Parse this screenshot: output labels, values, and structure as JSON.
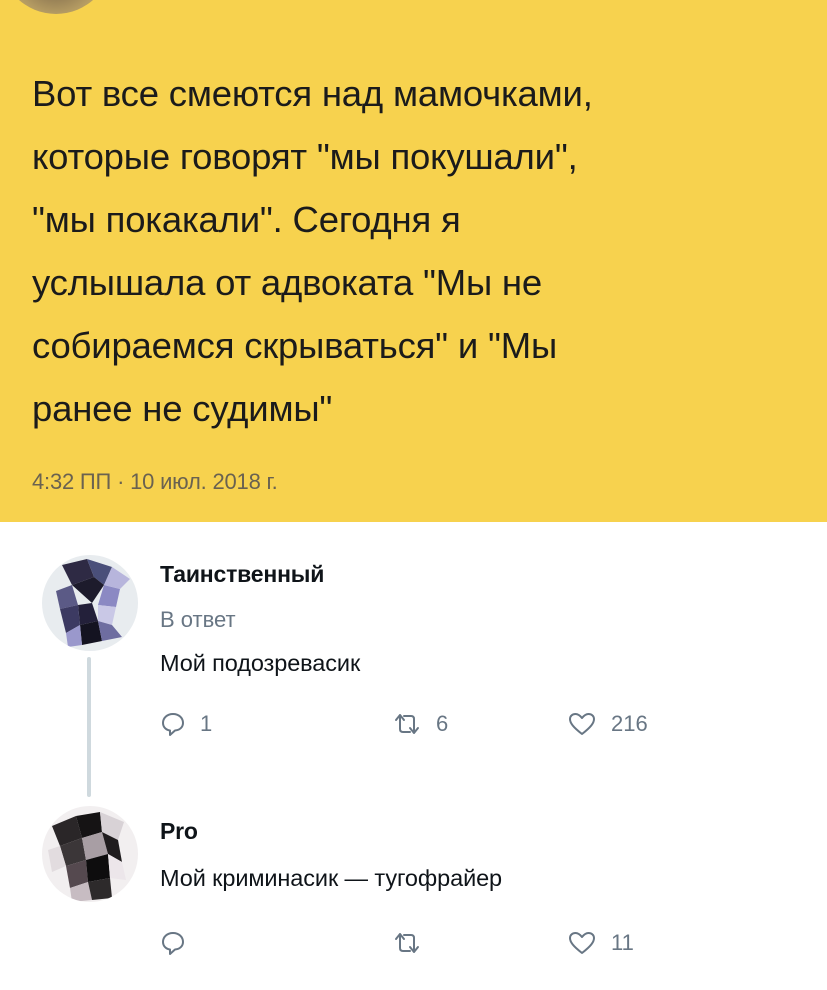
{
  "main_tweet": {
    "text": "Вот все смеются над мамочками,\nкоторые говорят \"мы покушали\",\n\"мы покакали\". Сегодня я\nуслышала от адвоката \"Мы не\nсобираемся скрываться\" и \"Мы\nранее не судимы\"",
    "timestamp": "4:32 ПП · 10 июл. 2018 г.",
    "background_color": "#f7d24e"
  },
  "replies": [
    {
      "name": "Таинственный",
      "in_reply_label": "В ответ",
      "text": "Мой подозревасик",
      "actions": {
        "reply_icon": "comment-icon",
        "reply_count": "1",
        "retweet_icon": "retweet-icon",
        "retweet_count": "6",
        "like_icon": "heart-icon",
        "like_count": "216"
      }
    },
    {
      "name": "Pro",
      "text": "Мой криминасик — тугофрайер",
      "actions": {
        "reply_icon": "comment-icon",
        "reply_count": "",
        "retweet_icon": "retweet-icon",
        "retweet_count": "",
        "like_icon": "heart-icon",
        "like_count": "11"
      }
    }
  ],
  "colors": {
    "thread_line": "#cfd9de",
    "secondary_text": "#687684",
    "primary_text": "#0f1419"
  }
}
